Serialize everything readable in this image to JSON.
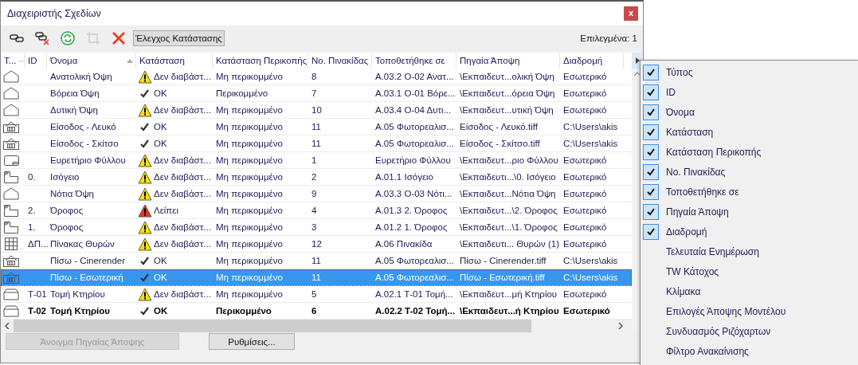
{
  "window": {
    "title": "Διαχειριστής Σχεδίων",
    "close_label": "x"
  },
  "toolbar": {
    "tools": [
      {
        "kind": "link",
        "disabled": false
      },
      {
        "kind": "unlink",
        "disabled": false
      },
      {
        "kind": "refresh",
        "disabled": false
      },
      {
        "kind": "crop",
        "disabled": true
      },
      {
        "kind": "delete",
        "disabled": false
      }
    ],
    "check_button": "Έλεγχος Κατάστασης",
    "selection_count": "Επιλεγμένα: 1"
  },
  "table": {
    "columns": [
      {
        "label": "Τ...",
        "kind": "secondary"
      },
      {
        "label": "ID",
        "kind": "plain"
      },
      {
        "label": "Όνομα",
        "kind": "primary"
      },
      {
        "label": "Κατάσταση",
        "kind": "plain"
      },
      {
        "label": "Κατάσταση Περικοπής",
        "kind": "plain"
      },
      {
        "label": "Νο. Πινακίδας",
        "kind": "plain"
      },
      {
        "label": "Τοποθετήθηκε σε",
        "kind": "plain"
      },
      {
        "label": "Πηγαία Άποψη",
        "kind": "plain"
      },
      {
        "label": "Διαδρομή",
        "kind": "plain"
      }
    ],
    "rows": [
      {
        "kind": "elevation",
        "name": "Ανατολική Όψη",
        "status": {
          "kind": "warning",
          "text": "Δεν διαβάστ..."
        },
        "clip": "Μη περικομμένο",
        "sheet": "8",
        "placed": "Α.03.2 Ο-02 Ανατ...",
        "source": "\\Εκπαιδευτ...ολική Όψη",
        "path": "Εσωτερικό",
        "selected": false,
        "bold": false
      },
      {
        "kind": "elevation",
        "name": "Βόρεια Όψη",
        "status": {
          "kind": "ok",
          "text": "OK"
        },
        "clip": "Περικομμένο",
        "sheet": "7",
        "placed": "Α.03.1 Ο-01 Βόρε...",
        "source": "\\Εκπαιδευτ...όρεια Όψη",
        "path": "Εσωτερικό",
        "selected": false,
        "bold": false
      },
      {
        "kind": "elevation",
        "name": "Δυτική Όψη",
        "status": {
          "kind": "warning",
          "text": "Δεν διαβάστ..."
        },
        "clip": "Μη περικομμένο",
        "sheet": "10",
        "placed": "Α.03.4 Ο-04 Δυτι...",
        "source": "\\Εκπαιδευτ...υτική Όψη",
        "path": "Εσωτερικό",
        "selected": false,
        "bold": false
      },
      {
        "kind": "render",
        "name": "Είσοδος - Λευκό",
        "status": {
          "kind": "ok",
          "text": "OK"
        },
        "clip": "Μη περικομμένο",
        "sheet": "11",
        "placed": "Α.05 Φωτορεαλισ...",
        "source": "Είσοδος - Λευκό.tiff",
        "path": "C:\\Users\\akis",
        "selected": false,
        "bold": false
      },
      {
        "kind": "render",
        "name": "Είσοδος - Σκίτσο",
        "status": {
          "kind": "ok",
          "text": "OK"
        },
        "clip": "Μη περικομμένο",
        "sheet": "11",
        "placed": "Α.05 Φωτορεαλισ...",
        "source": "Είσοδος - Σκίτσο.tiff",
        "path": "C:\\Users\\akis",
        "selected": false,
        "bold": false
      },
      {
        "kind": "index",
        "name": "Ευρετήριο Φύλλου",
        "status": {
          "kind": "warning",
          "text": "Δεν διαβάστ..."
        },
        "clip": "Μη περικομμένο",
        "sheet": "1",
        "placed": "Ευρετήριο Φύλλου",
        "source": "\\Εκπαιδευτ...ριο Φύλλου",
        "path": "Εσωτερικό",
        "selected": false,
        "bold": false
      },
      {
        "kind": "floor",
        "id": "0.",
        "name": "Ισόγειο",
        "status": {
          "kind": "warning",
          "text": "Δεν διαβάστ..."
        },
        "clip": "Μη περικομμένο",
        "sheet": "2",
        "placed": "Α.01.1 Ισόγειο",
        "source": "\\Εκπαιδευτι...\\0. Ισόγειο",
        "path": "Εσωτερικό",
        "selected": false,
        "bold": false
      },
      {
        "kind": "elevation",
        "name": "Νότια Όψη",
        "status": {
          "kind": "warning",
          "text": "Δεν διαβάστ..."
        },
        "clip": "Μη περικομμένο",
        "sheet": "9",
        "placed": "Α.03.3 Ο-03 Νότι...",
        "source": "\\Εκπαιδευτ...Νότια Όψη",
        "path": "Εσωτερικό",
        "selected": false,
        "bold": false
      },
      {
        "kind": "floor",
        "id": "2.",
        "name": "Όροφος",
        "status": {
          "kind": "missing",
          "text": "Λείπει"
        },
        "clip": "Μη περικομμένο",
        "sheet": "4",
        "placed": "Α.01.3 2. Όροφος",
        "source": "\\Εκπαιδευτ...\\2. Όροφος",
        "path": "Εσωτερικό",
        "selected": false,
        "bold": false
      },
      {
        "kind": "floor",
        "id": "1.",
        "name": "Όροφος",
        "status": {
          "kind": "warning",
          "text": "Δεν διαβάστ..."
        },
        "clip": "Μη περικομμένο",
        "sheet": "3",
        "placed": "Α.01.2 1. Όροφος",
        "source": "\\Εκπαιδευτ...\\1. Όροφος",
        "path": "Εσωτερικό",
        "selected": false,
        "bold": false
      },
      {
        "kind": "schedule",
        "id": "ΔΠ...",
        "name": "Πίνακας Θυρών",
        "status": {
          "kind": "warning",
          "text": "Δεν διαβάστ..."
        },
        "clip": "Μη περικομμένο",
        "sheet": "12",
        "placed": "Α.06 Πινακίδα",
        "source": "\\Εκπαιδευτι... Θυρών (1)",
        "path": "Εσωτερικό",
        "selected": false,
        "bold": false
      },
      {
        "kind": "render",
        "name": "Πίσω - Cinerender",
        "status": {
          "kind": "ok",
          "text": "OK"
        },
        "clip": "Μη περικομμένο",
        "sheet": "11",
        "placed": "Α.05 Φωτορεαλισ...",
        "source": "Πίσω - Cinerender.tiff",
        "path": "C:\\Users\\akis",
        "selected": false,
        "bold": false
      },
      {
        "kind": "render",
        "name": "Πίσω - Εσωτερική",
        "status": {
          "kind": "ok",
          "text": "OK"
        },
        "clip": "Μη περικομμένο",
        "sheet": "11",
        "placed": "Α.05 Φωτορεαλισ...",
        "source": "Πίσω - Εσωτερική.tiff",
        "path": "C:\\Users\\akis",
        "selected": true,
        "bold": false
      },
      {
        "kind": "section",
        "id": "Τ-01",
        "name": "Τομή Κτηρίου",
        "status": {
          "kind": "warning",
          "text": "Δεν διαβάστ..."
        },
        "clip": "Μη περικομμένο",
        "sheet": "5",
        "placed": "Α.02.1 Τ-01 Τομή...",
        "source": "\\Εκπαιδευτ...μή Κτηρίου",
        "path": "Εσωτερικό",
        "selected": false,
        "bold": false
      },
      {
        "kind": "section",
        "id": "Τ-02",
        "name": "Τομή Κτηρίου",
        "status": {
          "kind": "ok",
          "text": "OK"
        },
        "clip": "Περικομμένο",
        "sheet": "6",
        "placed": "Α.02.2 Τ-02 Τομή...",
        "source": "\\Εκπαιδευτ...ή Κτηρίου",
        "path": "Εσωτερικό",
        "selected": false,
        "bold": true
      }
    ]
  },
  "buttons": [
    {
      "label": "Άνοιγμα Πηγαίας Άποψης",
      "disabled": true
    },
    {
      "label": "Ρυθμίσεις...",
      "disabled": false
    }
  ],
  "column_menu": {
    "items": [
      {
        "label": "Τύπος",
        "checked": true
      },
      {
        "label": "ID",
        "checked": true
      },
      {
        "label": "Όνομα",
        "checked": true
      },
      {
        "label": "Κατάσταση",
        "checked": true
      },
      {
        "label": "Κατάσταση Περικοπής",
        "checked": true
      },
      {
        "label": "Νο. Πινακίδας",
        "checked": true
      },
      {
        "label": "Τοποθετήθηκε σε",
        "checked": true
      },
      {
        "label": "Πηγαία Άποψη",
        "checked": true
      },
      {
        "label": "Διαδρομή",
        "checked": true
      },
      {
        "label": "Τελευταία Ενημέρωση",
        "checked": false
      },
      {
        "label": "TW Κάτοχος",
        "checked": false
      },
      {
        "label": "Κλίμακα",
        "checked": false
      },
      {
        "label": "Επιλογές Άποψης Μοντέλου",
        "checked": false
      },
      {
        "label": "Συνδυασμός Ριζόχαρτων",
        "checked": false
      },
      {
        "label": "Φίλτρο Ανακαίνισης",
        "checked": false
      }
    ]
  }
}
